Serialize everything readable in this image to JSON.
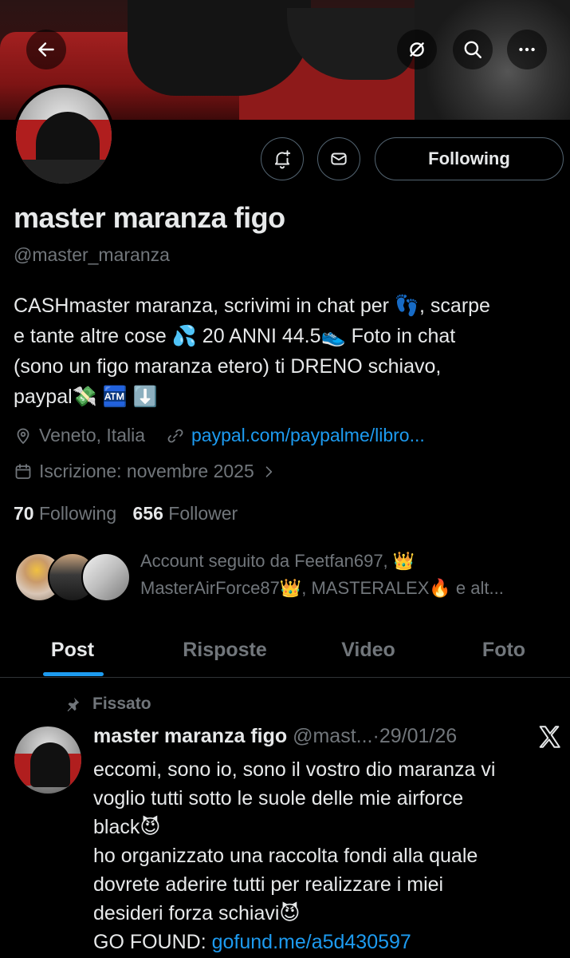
{
  "header": {
    "back_icon": "arrow-left-icon",
    "hide_icon": "circle-slash-icon",
    "search_icon": "search-icon",
    "more_icon": "more-dots-icon"
  },
  "profile": {
    "name": "master maranza figo",
    "handle": "@master_maranza",
    "bio_lines": [
      "CASHmaster maranza, scrivimi in chat per 👣, scarpe",
      "e tante altre cose 💦 20 ANNI 44.5👟 Foto in chat",
      "(sono un figo maranza etero) ti DRENO schiavo,",
      "paypal💸 🏧 ⬇️"
    ],
    "location": "Veneto, Italia",
    "website": "paypal.com/paypalme/libro...",
    "joined": "Iscrizione: novembre 2025",
    "following_count": "70",
    "following_label": "Following",
    "followers_count": "656",
    "followers_label": "Follower",
    "following_button": "Following",
    "followed_by_lines": [
      "Account seguito da Feetfan697, 👑",
      "MasterAirForce87👑, MASTERALEX🔥 e alt..."
    ]
  },
  "tabs": [
    {
      "label": "Post",
      "active": true
    },
    {
      "label": "Risposte",
      "active": false
    },
    {
      "label": "Video",
      "active": false
    },
    {
      "label": "Foto",
      "active": false
    }
  ],
  "pinned_post": {
    "pinned_label": "Fissato",
    "author": "master maranza figo",
    "handle_truncated": "@mast...",
    "separator": "·",
    "date": "29/01/26",
    "body_lines": [
      "eccomi, sono io, sono il vostro dio maranza vi",
      "voglio tutti sotto le suole delle mie airforce",
      "black😈",
      "ho organizzato una raccolta fondi alla quale",
      "dovrete aderire tutti per realizzare i miei",
      "desideri forza schiavi😈"
    ],
    "link_prefix": "GO FOUND: ",
    "link_text": "gofund.me/a5d430597"
  },
  "colors": {
    "background": "#000000",
    "text_primary": "#e7e9ea",
    "text_secondary": "#71767b",
    "accent": "#1d9bf0",
    "border": "#2f3336"
  }
}
